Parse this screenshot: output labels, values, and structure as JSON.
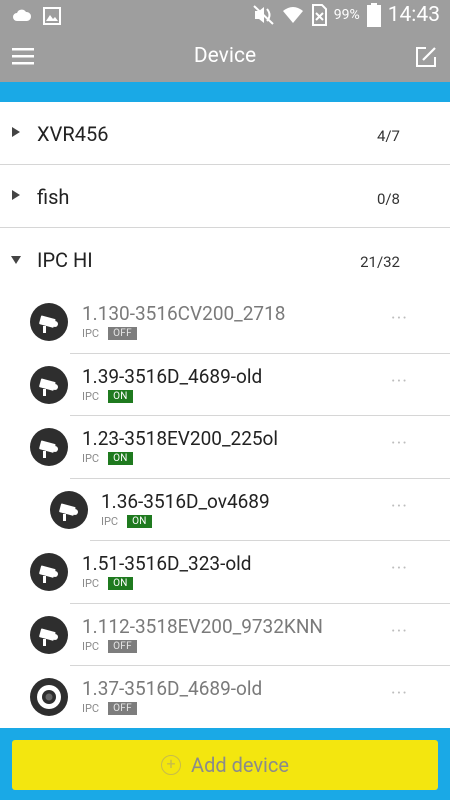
{
  "status_bar": {
    "battery": "99%",
    "time": "14:43"
  },
  "app_bar": {
    "title": "Device"
  },
  "groups": [
    {
      "name": "XVR456",
      "count": "4/7",
      "expanded": false
    },
    {
      "name": "fish",
      "count": "0/8",
      "expanded": false
    },
    {
      "name": "IPC HI",
      "count": "21/32",
      "expanded": true
    }
  ],
  "devices": [
    {
      "name": "1.130-3516CV200_2718",
      "type": "IPC",
      "status": "OFF",
      "icon": "camera-icon",
      "nested": false
    },
    {
      "name": "1.39-3516D_4689-old",
      "type": "IPC",
      "status": "ON",
      "icon": "camera-icon",
      "nested": false
    },
    {
      "name": "1.23-3518EV200_225ol",
      "type": "IPC",
      "status": "ON",
      "icon": "camera-icon",
      "nested": false
    },
    {
      "name": "1.36-3516D_ov4689",
      "type": "IPC",
      "status": "ON",
      "icon": "camera-icon",
      "nested": true
    },
    {
      "name": "1.51-3516D_323-old",
      "type": "IPC",
      "status": "ON",
      "icon": "camera-icon",
      "nested": false
    },
    {
      "name": "1.112-3518EV200_9732KNN",
      "type": "IPC",
      "status": "OFF",
      "icon": "camera-icon",
      "nested": false
    },
    {
      "name": "1.37-3516D_4689-old",
      "type": "IPC",
      "status": "OFF",
      "icon": "fisheye-camera-icon",
      "nested": false
    }
  ],
  "more_label": "···",
  "footer": {
    "add_label": "Add device"
  },
  "colors": {
    "app_bar": "#9e9e9e",
    "accent_blue": "#1aa9e6",
    "add_button": "#f3e60f",
    "on_badge": "#1f7a1f",
    "off_badge": "#7d7d7d"
  }
}
